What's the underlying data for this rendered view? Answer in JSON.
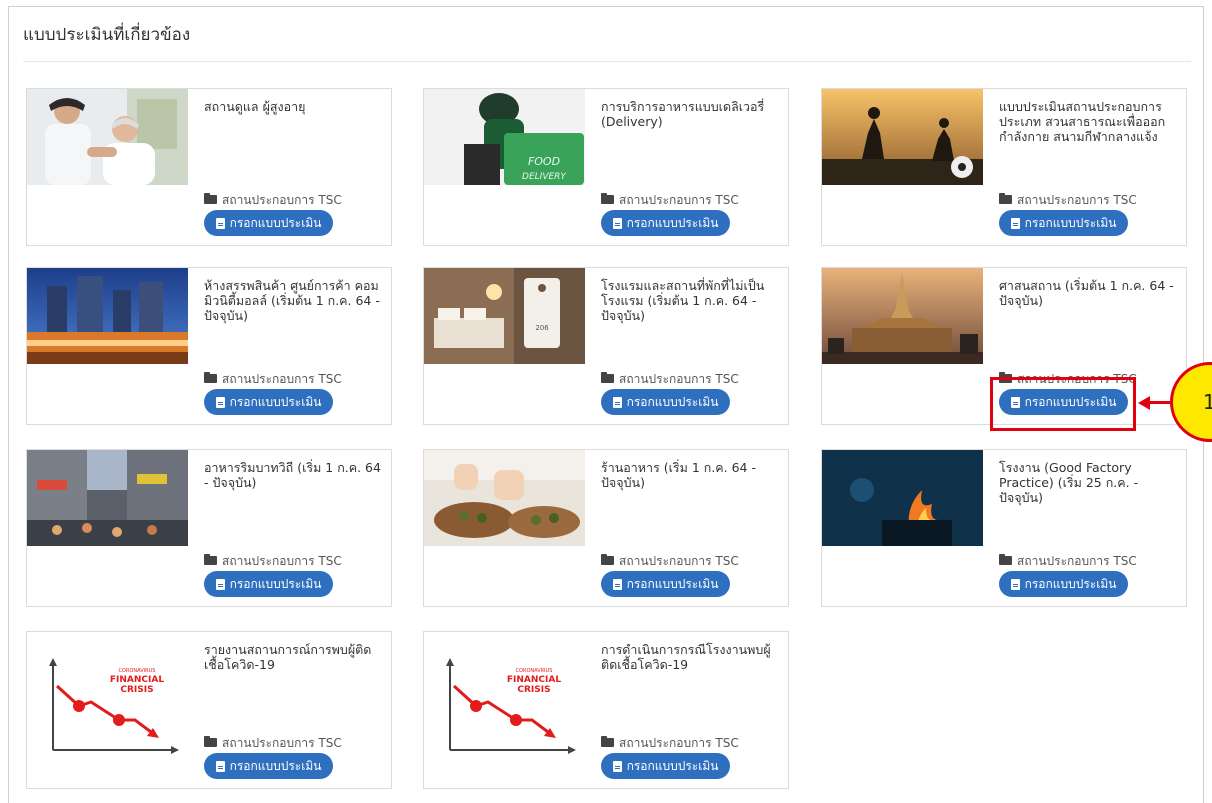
{
  "section": {
    "title": "แบบประเมินที่เกี่ยวข้อง"
  },
  "accent_color": "#2f6fbf",
  "annotation": {
    "marker_label": "1",
    "color": "#e1000f",
    "fill": "#ffe800"
  },
  "cards": [
    {
      "title": "สถานดูแล ผู้สูงอายุ",
      "category": "สถานประกอบการ TSC",
      "button": "กรอกแบบประเมิน",
      "image": "elderly-care-photo"
    },
    {
      "title": "การบริการอาหารแบบเดลิเวอรี่ (Delivery)",
      "category": "สถานประกอบการ TSC",
      "button": "กรอกแบบประเมิน",
      "image": "food-delivery-photo"
    },
    {
      "title": "แบบประเมินสถานประกอบการประเภท สวนสาธารณะเพื่อออกกำลังกาย สนามกีฬากลางแจ้ง",
      "category": "สถานประกอบการ TSC",
      "button": "กรอกแบบประเมิน",
      "image": "football-sunset-photo"
    },
    {
      "title": "ห้างสรรพสินค้า ศูนย์การค้า คอมมิวนิตี้มอลล์ (เริ่มต้น 1 ก.ค. 64 - ปัจจุบัน)",
      "category": "สถานประกอบการ TSC",
      "button": "กรอกแบบประเมิน",
      "image": "shopping-mall-photo"
    },
    {
      "title": "โรงแรมและสถานที่พักที่ไม่เป็นโรงแรม (เริ่มต้น 1 ก.ค. 64 - ปัจจุบัน)",
      "category": "สถานประกอบการ TSC",
      "button": "กรอกแบบประเมิน",
      "image": "hotel-room-photo",
      "room_tag": "206"
    },
    {
      "title": "ศาสนสถาน (เริ่มต้น 1 ก.ค. 64 - ปัจจุบัน)",
      "category": "สถานประกอบการ TSC",
      "button": "กรอกแบบประเมิน",
      "image": "temple-photo"
    },
    {
      "title": "อาหารริมบาทวิถี (เริ่ม 1 ก.ค. 64 - ปัจจุบัน)",
      "category": "สถานประกอบการ TSC",
      "button": "กรอกแบบประเมิน",
      "image": "street-food-photo"
    },
    {
      "title": "ร้านอาหาร (เริ่ม 1 ก.ค. 64 - ปัจจุบัน)",
      "category": "สถานประกอบการ TSC",
      "button": "กรอกแบบประเมิน",
      "image": "restaurant-dish-photo"
    },
    {
      "title": "โรงงาน (Good Factory Practice) (เริ่ม 25 ก.ค. - ปัจจุบัน)",
      "category": "สถานประกอบการ TSC",
      "button": "กรอกแบบประเมิน",
      "image": "factory-fire-photo"
    },
    {
      "title": "รายงานสถานการณ์การพบผู้ติดเชื้อโควิด-19",
      "category": "สถานประกอบการ TSC",
      "button": "กรอกแบบประเมิน",
      "image": "financial-crisis-chart"
    },
    {
      "title": "การดำเนินการกรณีโรงงานพบผู้ติดเชื้อโควิด-19",
      "category": "สถานประกอบการ TSC",
      "button": "กรอกแบบประเมิน",
      "image": "financial-crisis-chart"
    }
  ],
  "crisis_graphic": {
    "line1": "CORONAVIRUS",
    "line2": "FINANCIAL",
    "line3": "CRISIS"
  },
  "delivery_graphic": {
    "line1": "FOOD",
    "line2": "DELIVERY"
  }
}
